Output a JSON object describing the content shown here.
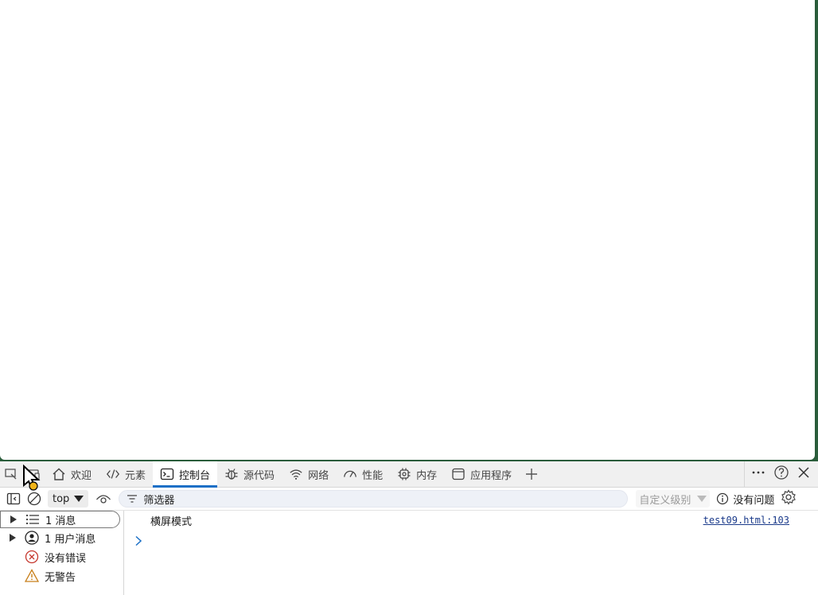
{
  "tabs": [
    {
      "label": "欢迎",
      "icon": "home-icon"
    },
    {
      "label": "元素",
      "icon": "code-icon"
    },
    {
      "label": "控制台",
      "icon": "console-icon",
      "active": true
    },
    {
      "label": "源代码",
      "icon": "bug-icon"
    },
    {
      "label": "网络",
      "icon": "wifi-icon"
    },
    {
      "label": "性能",
      "icon": "gauge-icon"
    },
    {
      "label": "内存",
      "icon": "chip-icon"
    },
    {
      "label": "应用程序",
      "icon": "app-window-icon"
    }
  ],
  "toolbar": {
    "context": "top",
    "filter_placeholder": "筛选器",
    "levels_label": "自定义级别",
    "issues_label": "没有问题"
  },
  "sidebar": {
    "items": [
      {
        "label": "1 消息",
        "icon": "list-icon"
      },
      {
        "label": "1 用户消息",
        "icon": "user-icon"
      },
      {
        "label": "没有错误",
        "icon": "error-icon"
      },
      {
        "label": "无警告",
        "icon": "warning-icon"
      }
    ]
  },
  "console": {
    "messages": [
      {
        "text": "横屏模式",
        "source": "test09.html:103"
      }
    ]
  },
  "colors": {
    "accent": "#1a6fc6",
    "error": "#c5362c",
    "warning": "#c87f1a",
    "link": "#1a3a8a"
  }
}
